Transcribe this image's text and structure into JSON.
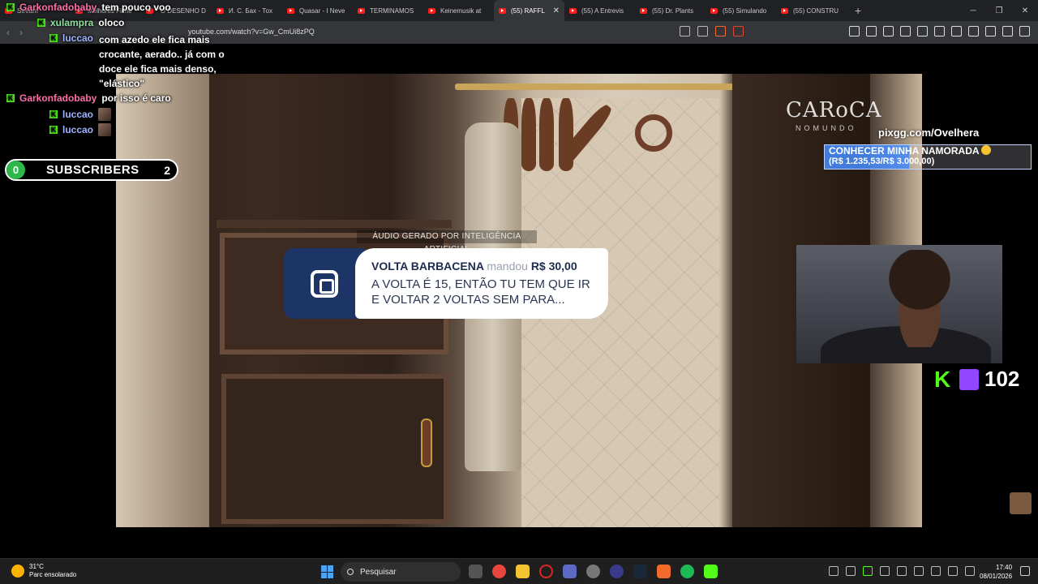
{
  "browser": {
    "tabs": [
      {
        "label": "Stream"
      },
      {
        "label": "Melhores Filme"
      },
      {
        "label": "\"O DESENHO D"
      },
      {
        "label": "И. С. Бах - Тоx"
      },
      {
        "label": "Quasar - I Neve"
      },
      {
        "label": "TERMINAMOS"
      },
      {
        "label": "Keinemusik at"
      },
      {
        "label": "(55) RAFFL"
      },
      {
        "label": "(55) A Entrevis"
      },
      {
        "label": "(55) Dr. Plants"
      },
      {
        "label": "(55) Simulando"
      },
      {
        "label": "(55) CONSTRU"
      }
    ],
    "active_tab_index": 7,
    "url": "youtube.com/watch?v=Gw_CmUi8zPQ"
  },
  "chat": {
    "messages": [
      {
        "user": "Garkonfadobaby",
        "text": "tem pouco voo",
        "color": "#ff6fa8"
      },
      {
        "user": "xulampra",
        "text": "oloco",
        "color": "#90e0a0"
      },
      {
        "user": "luccao",
        "text": "com azedo ele fica mais crocante, aerado.. já com o doce ele fica mais denso, \"elástico\"",
        "color": "#9fb4ff"
      },
      {
        "user": "Garkonfadobaby",
        "text": "por isso é caro",
        "color": "#ff6fa8"
      },
      {
        "user": "luccao",
        "text": "",
        "color": "#9fb4ff"
      },
      {
        "user": "luccao",
        "text": "",
        "color": "#9fb4ff"
      }
    ]
  },
  "subscribers": {
    "left_count": "0",
    "label": "SUBSCRIBERS",
    "right_count": "2"
  },
  "video": {
    "logo_main": "CARoCA",
    "logo_sub": "NOMUNDO"
  },
  "alert": {
    "ai_label": "ÁUDIO GERADO POR INTELIGÊNCIA ARTIFICIAL",
    "sender": "VOLTA BARBACENA",
    "verb": "mandou",
    "amount": "R$ 30,00",
    "message": "A VOLTA É 15, ENTÃO TU TEM QUE IR E VOLTAR 2 VOLTAS SEM PARA..."
  },
  "goal": {
    "pix": "pixgg.com/Ovelhera",
    "title": "CONHECER MINHA NAMORADA",
    "progress_text": "(R$ 1.235,53/R$ 3.000,00)",
    "progress_fraction": 0.41
  },
  "followers": {
    "count": "102"
  },
  "taskbar": {
    "temperature": "31°C",
    "weather": "Parc ensolarado",
    "search": "Pesquisar",
    "time": "17:40",
    "date": "08/01/2026"
  },
  "colors": {
    "kick_green": "#53fc18",
    "twitch_purple": "#9146ff",
    "alert_navy": "#1d3566"
  }
}
